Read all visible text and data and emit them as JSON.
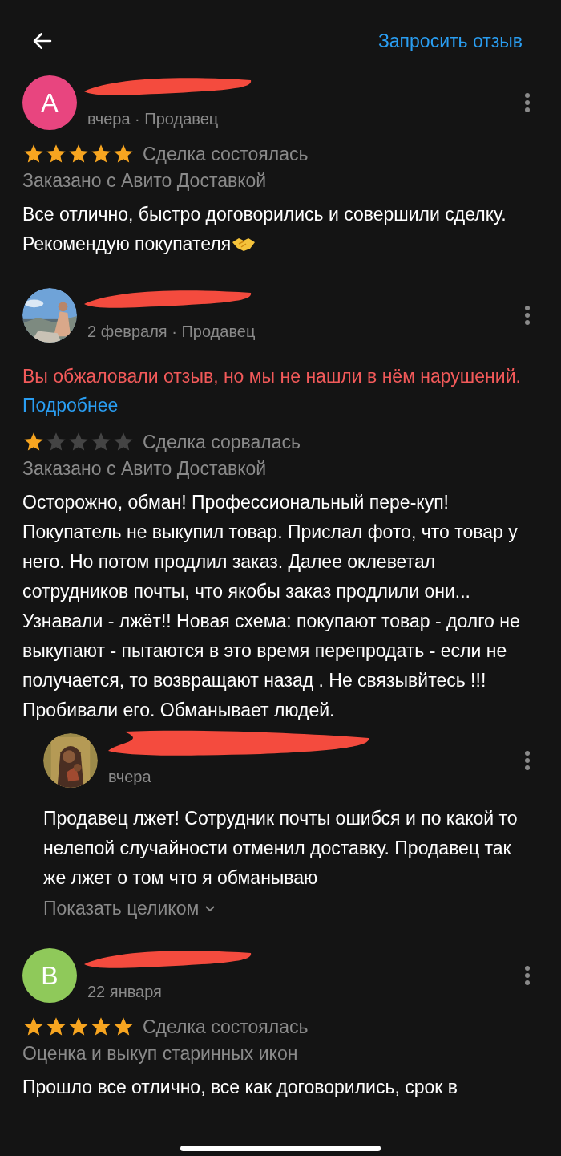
{
  "header": {
    "action": "Запросить отзыв"
  },
  "reviews": [
    {
      "avatar": {
        "kind": "letter",
        "letter": "А",
        "color": "#e8457f"
      },
      "name_hidden": true,
      "meta": "вчера · Продавец",
      "stars": 5,
      "deal": "Сделка состоялась",
      "source": "Заказано с Авито Доставкой",
      "text": "Все отлично, быстро договорились и совершили сделку. Рекомендую покупателя",
      "handshake": true
    },
    {
      "name_hidden": true,
      "meta": "2 февраля · Продавец",
      "notice": {
        "text": "Вы обжаловали отзыв, но мы не нашли в нём нарушений.",
        "link": "Подробнее"
      },
      "stars": 1,
      "deal": "Сделка сорвалась",
      "source": "Заказано с Авито Доставкой",
      "text": "Осторожно, обман! Профессиональный пере-куп! Покупатель не выкупил товар. Прислал фото, что товар у него. Но потом  продлил заказ. Далее оклеветал сотрудников почты, что якобы заказ продлили они... Узнавали - лжёт!! Новая схема: покупают товар - долго не выкупают - пытаются в это время перепродать - если не получается, то возвращают назад . Не связывйтесь !!!  Пробивали его. Обманывает людей.",
      "reply": {
        "name_hidden": true,
        "meta": "вчера",
        "text": "Продавец лжет! Сотрудник почты ошибся и по какой то нелепой случайности отменил доставку. Продавец так же лжет о том что я обманываю",
        "more": "Показать целиком"
      }
    },
    {
      "avatar": {
        "kind": "letter",
        "letter": "В",
        "color": "#8fc95a"
      },
      "name_hidden": true,
      "meta": "22 января",
      "stars": 5,
      "deal": "Сделка состоялась",
      "source": "Оценка и выкуп старинных икон",
      "text": "Прошло все отлично, все как договорились, срок в"
    }
  ]
}
